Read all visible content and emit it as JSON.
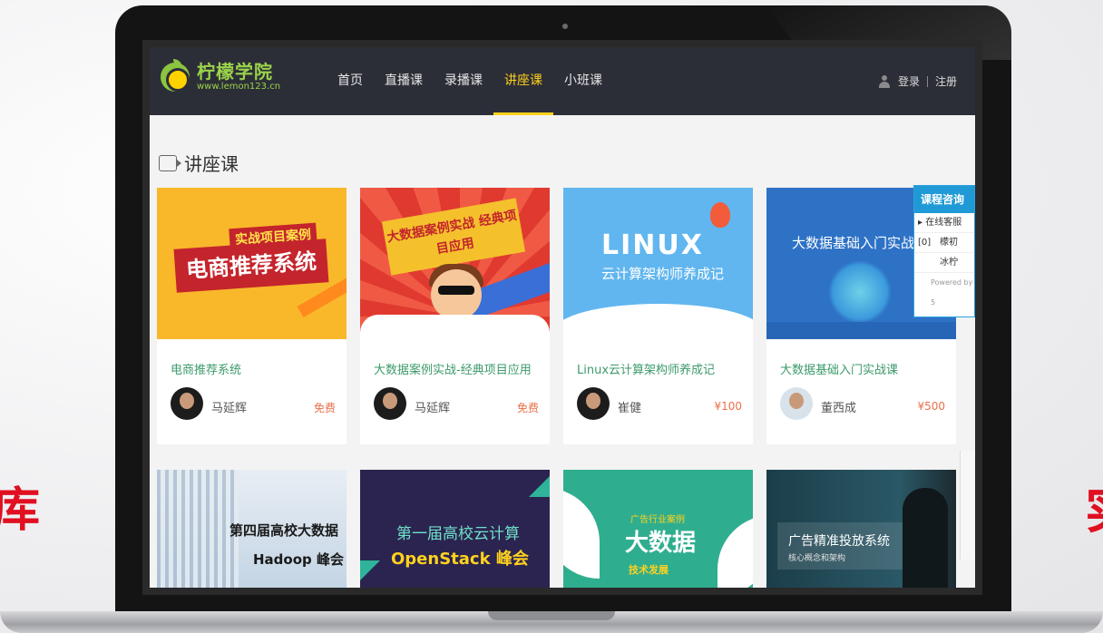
{
  "slide": {
    "left_glyph": "库",
    "right_glyph": "实"
  },
  "brand": {
    "name": "柠檬学院",
    "url": "www.lemon123.cn"
  },
  "nav": {
    "links": [
      {
        "label": "首页",
        "active": false
      },
      {
        "label": "直播课",
        "active": false
      },
      {
        "label": "录播课",
        "active": false
      },
      {
        "label": "讲座课",
        "active": true
      },
      {
        "label": "小班课",
        "active": false
      }
    ],
    "login": "登录",
    "register": "注册",
    "active_color": "#ffd21e"
  },
  "section": {
    "title": "讲座课"
  },
  "courses": [
    {
      "title": "电商推荐系统",
      "teacher": "马延辉",
      "price": "免费",
      "thumb": {
        "tag": "实战项目案例",
        "main": "电商推荐系统"
      }
    },
    {
      "title": "大数据案例实战-经典项目应用",
      "teacher": "马延辉",
      "price": "免费",
      "thumb": {
        "main": "大数据案例实战 经典项目应用"
      }
    },
    {
      "title": "Linux云计算架构师养成记",
      "teacher": "崔健",
      "price": "¥100",
      "thumb": {
        "main": "LINUX",
        "sub": "云计算架构师养成记"
      }
    },
    {
      "title": "大数据基础入门实战课",
      "teacher": "董西成",
      "price": "¥500",
      "thumb": {
        "main": "大数据基础入门实战"
      }
    },
    {
      "thumb": {
        "line1": "第四届高校大数据",
        "line2": "Hadoop 峰会"
      }
    },
    {
      "thumb": {
        "line1": "第一届高校云计算",
        "line2": "OpenStack 峰会"
      }
    },
    {
      "thumb": {
        "tag": "广告行业案例",
        "main": "大数据",
        "sub": "技术发展"
      }
    },
    {
      "thumb": {
        "line1": "广告精准投放系统",
        "line2": "核心概念和架构"
      }
    }
  ],
  "consult": {
    "header": "课程咨询",
    "online": "在线客服[0]",
    "agents": [
      "檬初",
      "冰柠"
    ],
    "footer": "Powered by 5"
  },
  "colors": {
    "nav_bg": "#2c2e37",
    "brand_green": "#9bd34a",
    "price": "#e8704a",
    "consult_blue": "#1f9ad6"
  }
}
